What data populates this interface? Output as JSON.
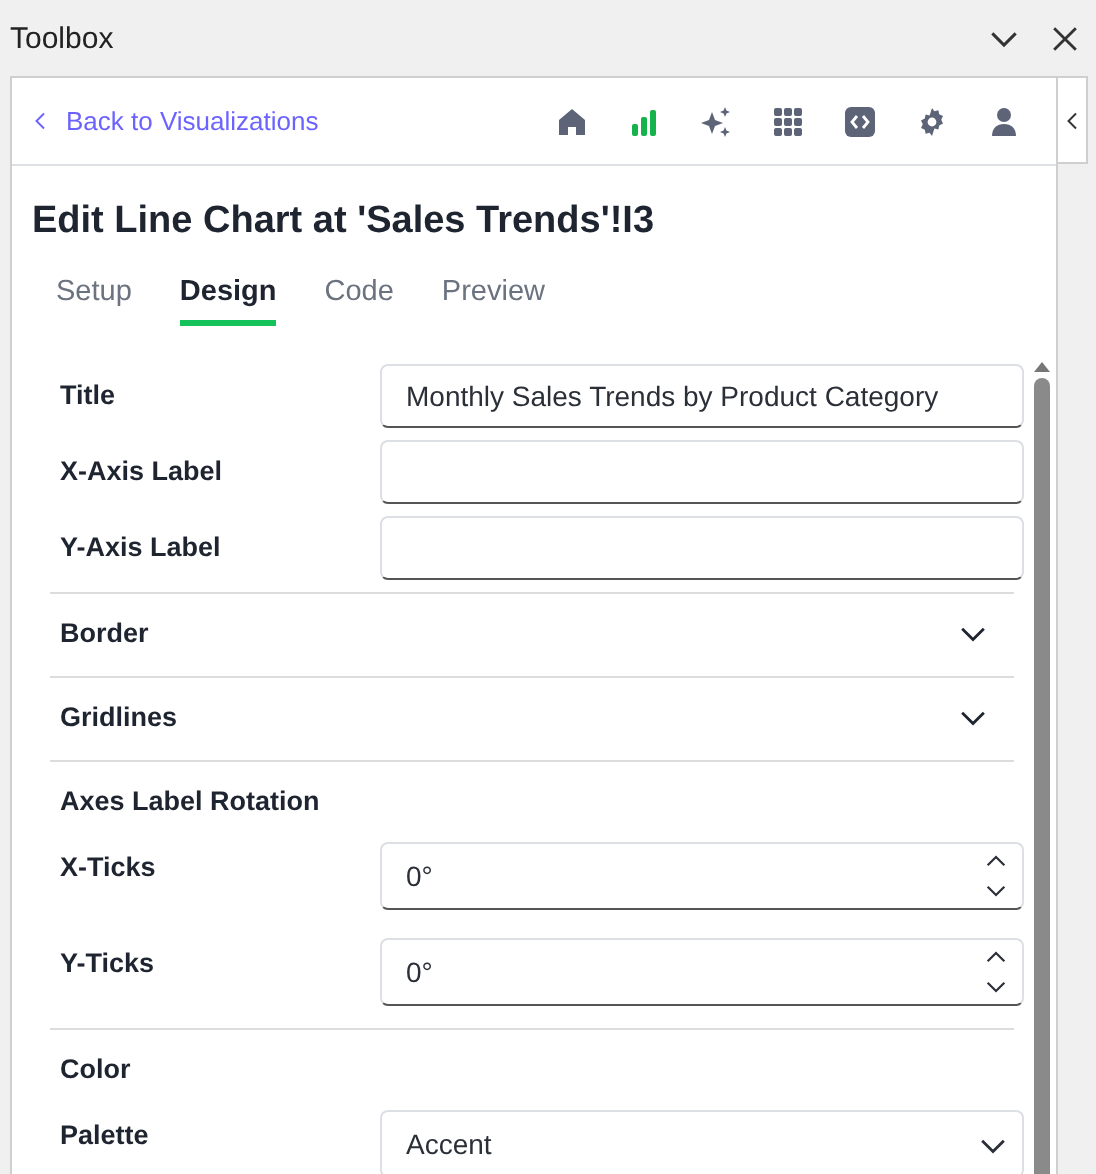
{
  "window": {
    "title": "Toolbox"
  },
  "back_link": {
    "label": "Back to Visualizations"
  },
  "nav_icons": [
    {
      "kind": "home",
      "selected": false
    },
    {
      "kind": "chart",
      "selected": true
    },
    {
      "kind": "sparkle",
      "selected": false
    },
    {
      "kind": "grid",
      "selected": false
    },
    {
      "kind": "code",
      "selected": false
    },
    {
      "kind": "gear",
      "selected": false
    },
    {
      "kind": "user",
      "selected": false
    }
  ],
  "heading": "Edit Line Chart at 'Sales Trends'!I3",
  "tabs": [
    {
      "label": "Setup",
      "selected": false
    },
    {
      "label": "Design",
      "selected": true
    },
    {
      "label": "Code",
      "selected": false
    },
    {
      "label": "Preview",
      "selected": false
    }
  ],
  "form": [
    {
      "kind": "text",
      "label": "Title",
      "value": "Monthly Sales Trends by Product Category"
    },
    {
      "kind": "text",
      "label": "X-Axis Label"
    },
    {
      "kind": "text",
      "label": "Y-Axis Label"
    },
    {
      "kind": "section",
      "label": "Border",
      "expanded": false
    },
    {
      "kind": "section",
      "label": "Gridlines",
      "expanded": false
    },
    {
      "kind": "group",
      "label": "Axes Label Rotation"
    },
    {
      "kind": "number",
      "label": "X-Ticks",
      "value": "0°"
    },
    {
      "kind": "number",
      "label": "Y-Ticks",
      "value": "0°"
    },
    {
      "kind": "group",
      "label": "Color"
    },
    {
      "kind": "select",
      "label": "Palette",
      "value": "Accent"
    }
  ]
}
